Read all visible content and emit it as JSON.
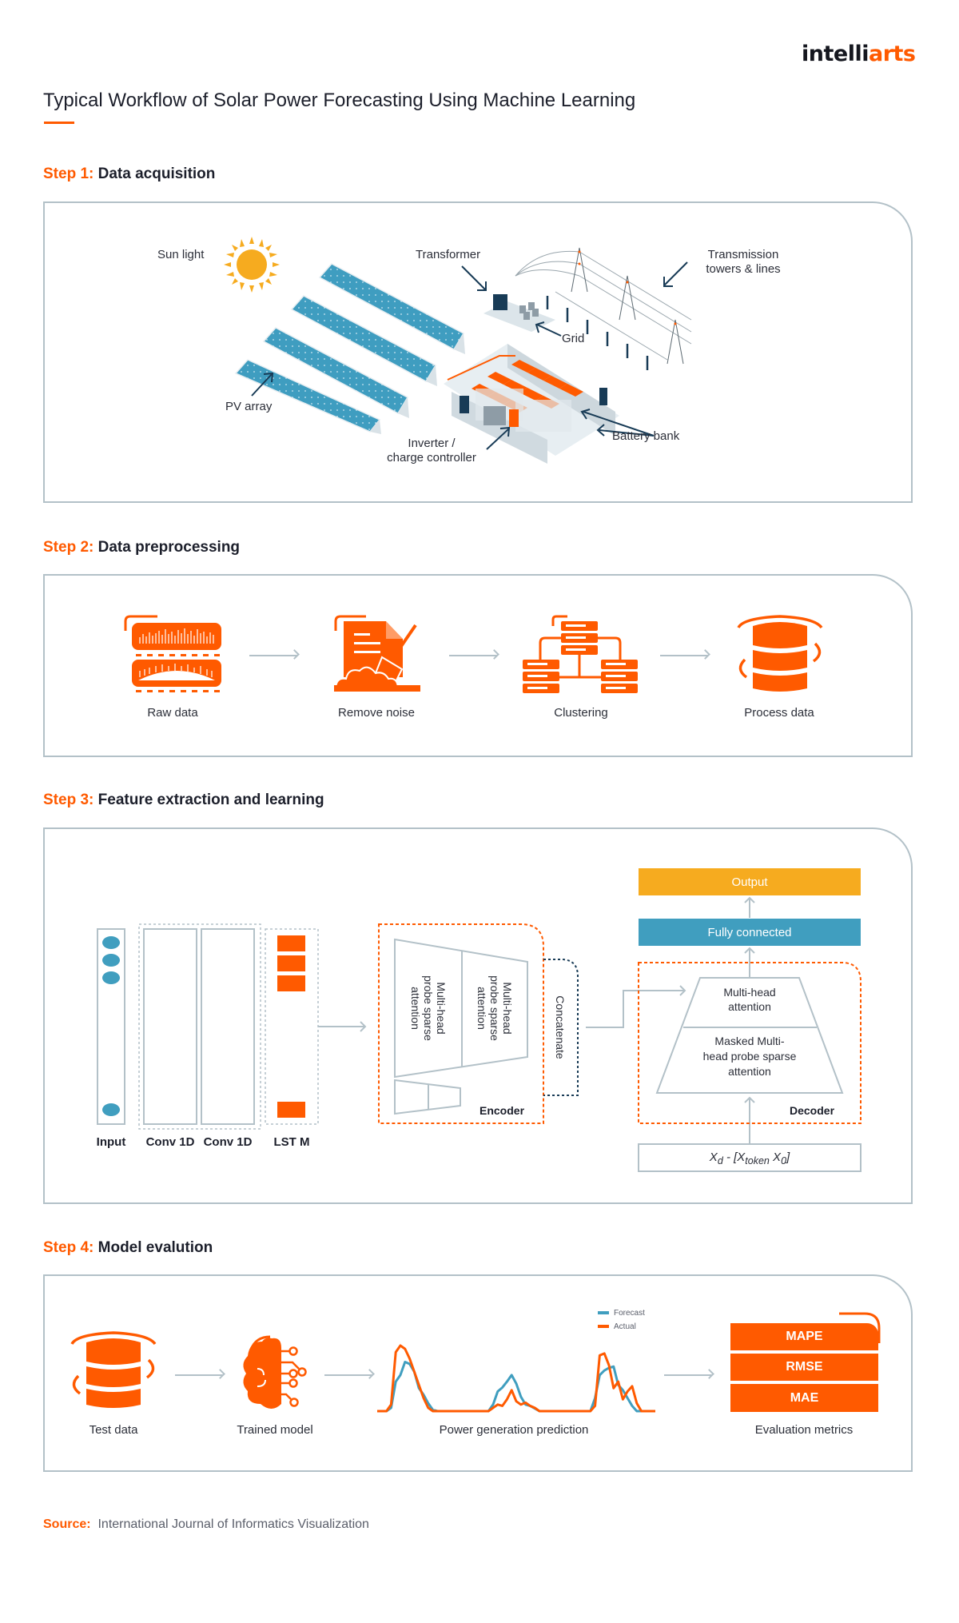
{
  "brand": {
    "logo_dark": "intelli",
    "logo_accent": "arts",
    "accent_color": "#ff5a00",
    "dark_color": "#15171f"
  },
  "title": "Typical Workflow of Solar Power Forecasting Using Machine Learning",
  "steps": [
    {
      "prefix": "Step 1:",
      "name": "Data acquisition",
      "labels": {
        "sun": "Sun light",
        "pv": "PV array",
        "transformer": "Transformer",
        "towers_1": "Transmission",
        "towers_2": "towers & lines",
        "grid": "Grid",
        "battery": "Battery bank",
        "inverter_1": "Inverter /",
        "inverter_2": "charge controller"
      }
    },
    {
      "prefix": "Step 2:",
      "name": "Data preprocessing",
      "items": [
        {
          "label": "Raw data",
          "icon": "raw-data-icon"
        },
        {
          "label": "Remove noise",
          "icon": "remove-noise-icon"
        },
        {
          "label": "Clustering",
          "icon": "clustering-icon"
        },
        {
          "label": "Process data",
          "icon": "database-icon"
        }
      ]
    },
    {
      "prefix": "Step 3:",
      "name": "Feature extraction and learning",
      "layers": [
        "Input",
        "Conv 1D",
        "Conv 1D",
        "LST M"
      ],
      "encoder": {
        "label": "Encoder",
        "block_1": [
          "Multi-head",
          "probe sparse",
          "attention"
        ],
        "block_2": [
          "Multi-head",
          "probe sparse",
          "attention"
        ],
        "concatenate": "Concatenate"
      },
      "decoder": {
        "label": "Decoder",
        "top": [
          "Multi-head",
          "attention"
        ],
        "bottom": [
          "Masked Multi-",
          "head probe sparse",
          "attention"
        ]
      },
      "fully_connected": "Fully connected",
      "output": "Output",
      "input_formula": {
        "x": "X",
        "d": "d",
        "sep": " - [",
        "token_x": "X",
        "token": "token",
        "zero_x": " X",
        "zero": "0",
        "close": "]"
      },
      "colors": {
        "output": "#f6ab1f",
        "fully_connected": "#409ebf",
        "input_nodes": "#409ebf",
        "lstm": "#ff5a00"
      }
    },
    {
      "prefix": "Step 4:",
      "name": "Model evalution",
      "items": [
        {
          "label": "Test data",
          "icon": "database-icon"
        },
        {
          "label": "Trained model",
          "icon": "brain-icon"
        },
        {
          "label": "Power generation prediction",
          "icon": "chart"
        },
        {
          "label": "Evaluation metrics",
          "icon": "metrics"
        }
      ],
      "metrics": [
        "MAPE",
        "RMSE",
        "MAE"
      ]
    }
  ],
  "chart_data": {
    "type": "line",
    "title": "",
    "xlabel": "",
    "ylabel": "",
    "legend": [
      "Forecast",
      "Actual"
    ],
    "legend_position": "top-right",
    "ylim": [
      0,
      1
    ],
    "x": [
      0,
      1,
      2,
      3,
      4,
      5,
      6,
      7,
      8,
      9,
      10,
      11,
      12,
      13,
      14,
      15,
      16,
      17,
      18,
      19,
      20,
      21,
      22,
      23,
      24,
      25,
      26,
      27,
      28,
      29,
      30,
      31,
      32,
      33,
      34,
      35,
      36,
      37,
      38,
      39,
      40,
      41,
      42,
      43,
      44,
      45,
      46,
      47,
      48,
      49,
      50,
      51,
      52,
      53,
      54,
      55,
      56,
      57,
      58,
      59,
      60
    ],
    "series": [
      {
        "name": "Forecast",
        "color": "#409ebf",
        "values": [
          0,
          0,
          0,
          0.05,
          0.45,
          0.55,
          0.75,
          0.72,
          0.6,
          0.35,
          0.25,
          0.12,
          0.02,
          0,
          0,
          0,
          0,
          0,
          0,
          0,
          0,
          0,
          0,
          0,
          0,
          0.1,
          0.3,
          0.36,
          0.45,
          0.55,
          0.42,
          0.22,
          0.1,
          0.08,
          0.04,
          0,
          0,
          0,
          0,
          0,
          0,
          0,
          0,
          0,
          0,
          0,
          0,
          0.2,
          0.55,
          0.62,
          0.66,
          0.68,
          0.4,
          0.32,
          0.2,
          0.08,
          0,
          0,
          0,
          0,
          0
        ]
      },
      {
        "name": "Actual",
        "color": "#ff5a00",
        "values": [
          0,
          0,
          0,
          0.1,
          0.9,
          1.0,
          0.95,
          0.8,
          0.6,
          0.4,
          0.2,
          0.05,
          0,
          0,
          0,
          0,
          0,
          0,
          0,
          0,
          0,
          0,
          0,
          0,
          0,
          0.05,
          0.1,
          0.08,
          0.18,
          0.32,
          0.15,
          0.1,
          0.13,
          0.08,
          0.05,
          0,
          0,
          0,
          0,
          0,
          0,
          0,
          0,
          0,
          0,
          0,
          0,
          0.08,
          0.85,
          0.88,
          0.7,
          0.35,
          0.45,
          0.18,
          0.3,
          0.38,
          0.12,
          0,
          0,
          0,
          0
        ]
      }
    ]
  },
  "source": {
    "key": "Source:",
    "value": "International Journal of Informatics Visualization"
  }
}
